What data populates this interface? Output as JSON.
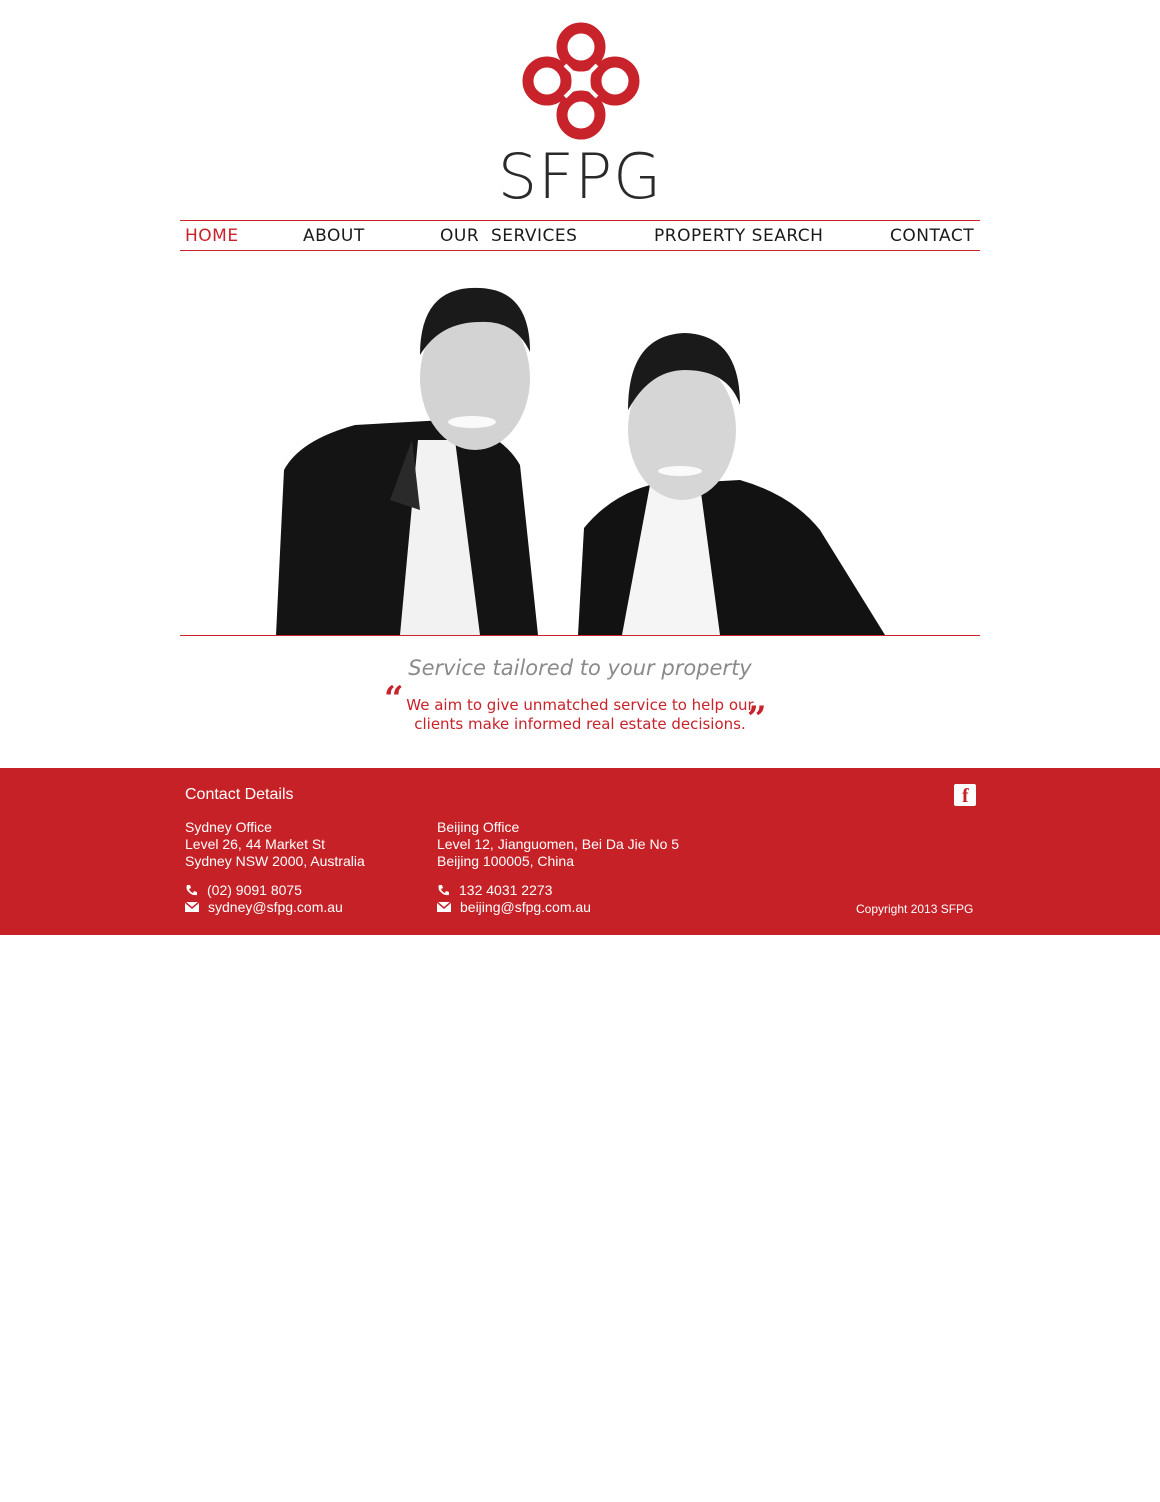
{
  "brand": {
    "name": "SFPG",
    "accent": "#c8222a"
  },
  "nav": {
    "items": [
      {
        "label": "HOME",
        "active": true
      },
      {
        "label": "ABOUT",
        "active": false
      },
      {
        "label": "OUR  SERVICES",
        "active": false
      },
      {
        "label": "PROPERTY SEARCH",
        "active": false
      },
      {
        "label": "CONTACT",
        "active": false
      }
    ]
  },
  "hero": {
    "image": "two-smiling-men-in-suits-photo"
  },
  "tagline": "Service tailored to your property",
  "quote": {
    "line1": "We aim to give unmatched service to help our",
    "line2": "clients make informed real estate decisions.",
    "open": "“",
    "close": "”"
  },
  "footer": {
    "title": "Contact Details",
    "sydney": {
      "name": "Sydney Office",
      "line1": "Level 26, 44 Market St",
      "line2": "Sydney NSW 2000, Australia",
      "phone": "(02) 9091 8075",
      "email": "sydney@sfpg.com.au"
    },
    "beijing": {
      "name": "Beijing Office",
      "line1": "Level 12, Jianguomen, Bei Da Jie No 5",
      "line2": "Beijing 100005, China",
      "phone": "132 4031 2273",
      "email": "beijing@sfpg.com.au"
    },
    "facebook_icon": "facebook-icon",
    "copyright": "Copyright 2013  SFPG",
    "background": "#c62127"
  }
}
